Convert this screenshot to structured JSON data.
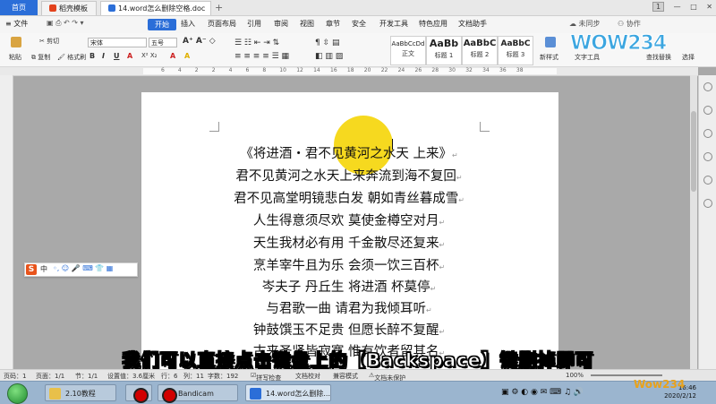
{
  "titlebar": {
    "home_tab": "首页",
    "template_tab": "稻壳模板",
    "doc_tab": "14.word怎么删除空格.doc",
    "notification_count": "1"
  },
  "menu": {
    "file": "文件",
    "start": "开始",
    "items": [
      "插入",
      "页面布局",
      "引用",
      "审阅",
      "视图",
      "章节",
      "安全",
      "开发工具",
      "特色应用",
      "文档助手"
    ],
    "sync": "未同步",
    "collab": "协作"
  },
  "ribbon": {
    "paste": "粘贴",
    "cut": "剪切",
    "copy": "复制",
    "format_painter": "格式刷",
    "font_name": "宋体",
    "font_size": "五号",
    "styles": [
      {
        "sample": "AaBbCcDd",
        "name": "正文"
      },
      {
        "sample": "AaBb",
        "name": "标题 1"
      },
      {
        "sample": "AaBbC",
        "name": "标题 2"
      },
      {
        "sample": "AaBbC",
        "name": "标题 3"
      }
    ],
    "new_style": "新样式",
    "text_tools": "文字工具",
    "find_replace": "查找替换",
    "select": "选择"
  },
  "ruler_numbers": [
    "6",
    "4",
    "2",
    "2",
    "4",
    "6",
    "8",
    "10",
    "12",
    "14",
    "16",
    "18",
    "20",
    "22",
    "24",
    "26",
    "28",
    "30",
    "32",
    "34",
    "36",
    "38"
  ],
  "poem_lines": [
    "《将进酒・君不见黄河之水天 上来》",
    "君不见黄河之水天上来奔流到海不复回",
    "君不见高堂明镜悲白发 朝如青丝暮成雪",
    "人生得意须尽欢 莫使金樽空对月",
    "天生我材必有用 千金散尽还复来",
    "烹羊宰牛且为乐 会须一饮三百杯",
    "岑夫子 丹丘生 将进酒 杯莫停",
    "与君歌一曲 请君为我倾耳听",
    "钟鼓馔玉不足贵 但愿长醉不复醒",
    "古来圣贤皆寂寞 惟有饮者留其名"
  ],
  "paragraph_mark": "↵",
  "caption": "我们可以直接点击键盘上的【Backspace】键删掉即可",
  "statusbar": {
    "page": "页码：1",
    "pages": "页面：1/1",
    "section": "节：1/1",
    "setting": "设置值：3.6厘米",
    "row": "行：6",
    "col": "列：11",
    "words": "字数：192",
    "spellcheck": "拼写检查",
    "doc_verify": "文档校对",
    "compat": "兼容模式",
    "protect": "文档未保护",
    "zoom": "100%"
  },
  "ime": {
    "logo": "S",
    "label": "中"
  },
  "taskbar": {
    "folder": "2.10教程",
    "bandicam": "Bandicam",
    "wps": "14.word怎么删除...",
    "time": "16:46",
    "date": "2020/2/12"
  },
  "watermark": {
    "top": "WOW234",
    "bottom": "Wow234"
  },
  "colors": {
    "accent": "#2b6ed8",
    "highlight": "#f5d400"
  }
}
